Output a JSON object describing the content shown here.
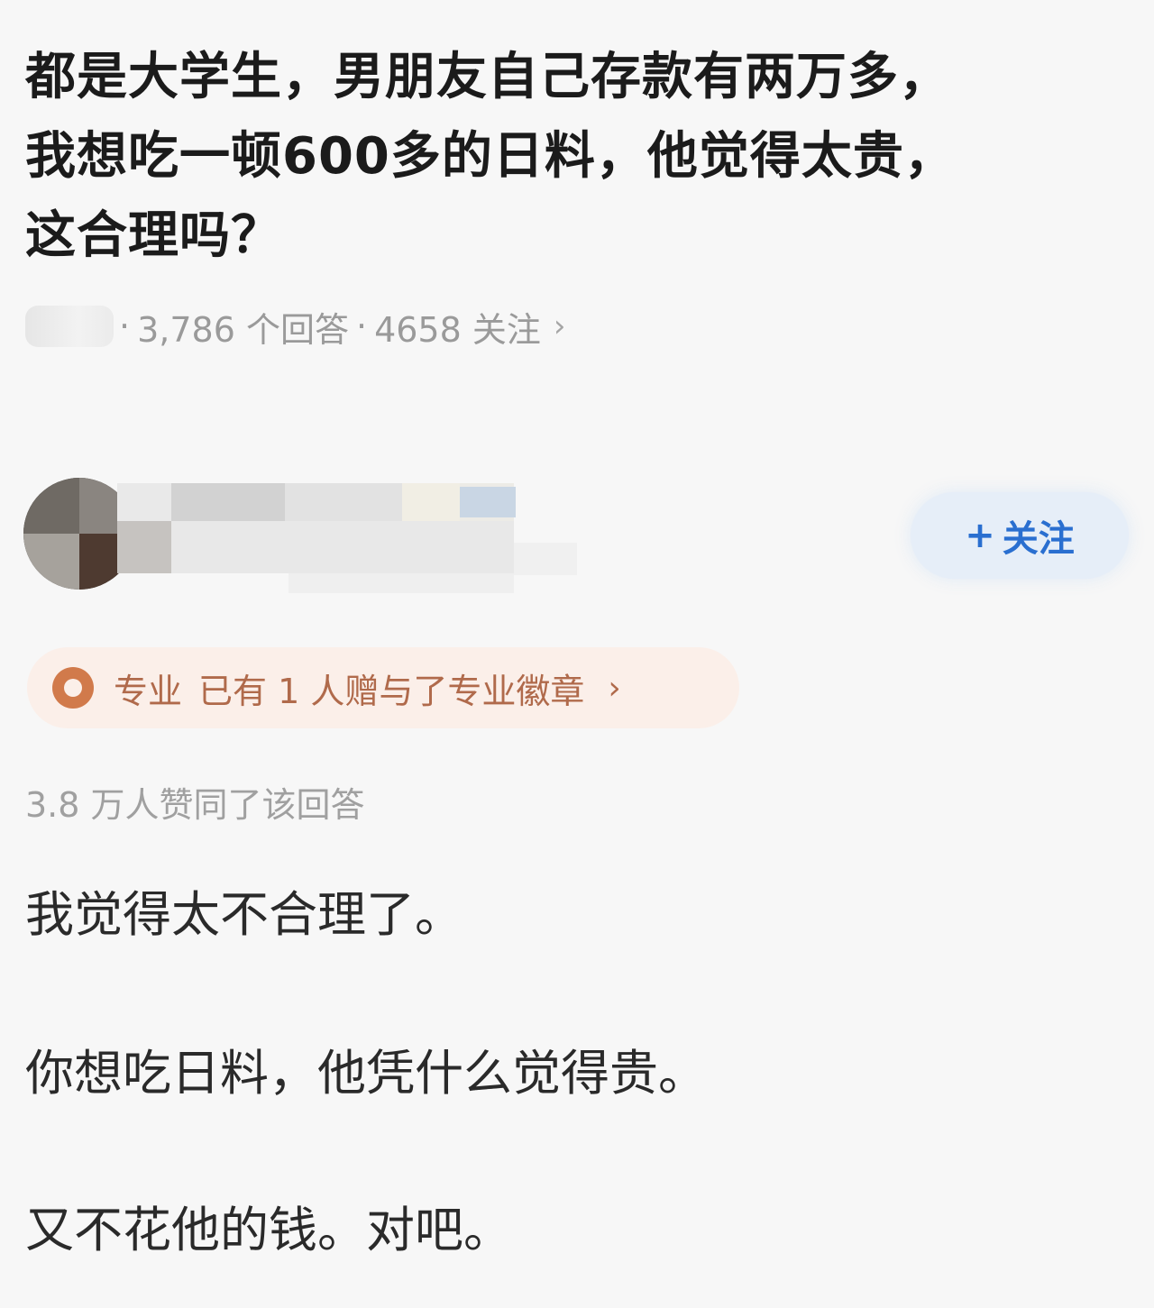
{
  "question": {
    "title_lines": [
      "都是大学生，男朋友自己存款有两万多，",
      "我想吃一顿600多的日料，他觉得太贵，",
      "这合理吗？"
    ],
    "meta": {
      "answers": "3,786 个回答",
      "separator": "·",
      "follows": "4658 关注",
      "chevron": "›"
    }
  },
  "author": {
    "follow_label": "关注",
    "follow_plus": "+"
  },
  "badge": {
    "type": "专业",
    "text": "已有 1 人赠与了专业徽章",
    "chevron": "›",
    "color": "#b06a4b"
  },
  "answer": {
    "likes": "3.8 万人赞同了该回答",
    "paragraphs": [
      "我觉得太不合理了。",
      "你想吃日料，他凭什么觉得贵。",
      "又不花他的钱。对吧。"
    ]
  },
  "colors": {
    "background": "#f7f7f7",
    "accent": "#2a6fd0",
    "meta_gray": "#9a9a9a"
  }
}
